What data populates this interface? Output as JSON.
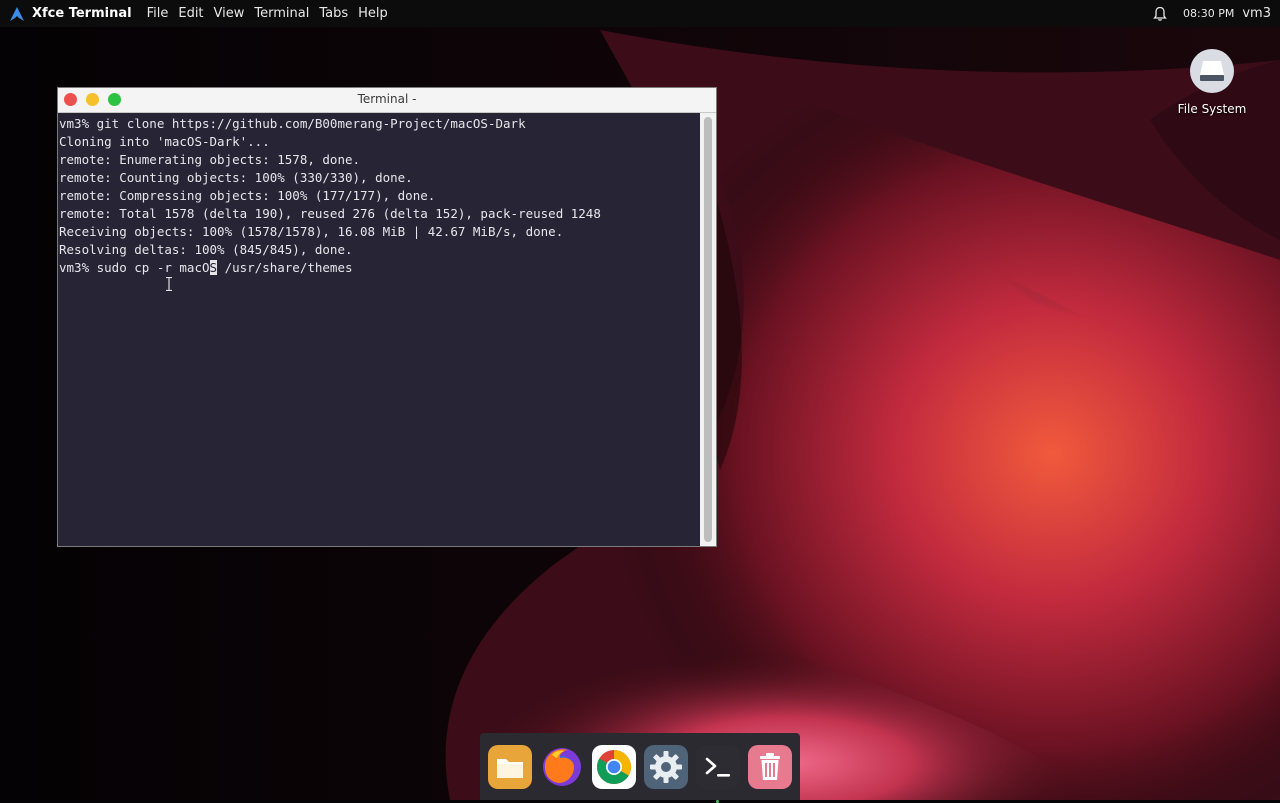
{
  "top_panel": {
    "app_name": "Xfce Terminal",
    "menu": [
      "File",
      "Edit",
      "View",
      "Terminal",
      "Tabs",
      "Help"
    ],
    "clock": "08:30 PM",
    "user": "vm3",
    "icons": {
      "logo": "arch-logo-icon",
      "notifications": "bell-icon"
    }
  },
  "desktop": {
    "icons": [
      {
        "label": "File System",
        "icon": "drive-icon"
      }
    ]
  },
  "terminal": {
    "title": "Terminal -",
    "lines": [
      "vm3% git clone https://github.com/B00merang-Project/macOS-Dark",
      "Cloning into 'macOS-Dark'...",
      "remote: Enumerating objects: 1578, done.",
      "remote: Counting objects: 100% (330/330), done.",
      "remote: Compressing objects: 100% (177/177), done.",
      "remote: Total 1578 (delta 190), reused 276 (delta 152), pack-reused 1248",
      "Receiving objects: 100% (1578/1578), 16.08 MiB | 42.67 MiB/s, done.",
      "Resolving deltas: 100% (845/845), done."
    ],
    "current_line": {
      "before_cursor": "vm3% sudo cp -r macO",
      "cursor_char": "S",
      "after_cursor": " /usr/share/themes"
    }
  },
  "dock": {
    "items": [
      {
        "name": "files",
        "icon": "folder-icon"
      },
      {
        "name": "firefox",
        "icon": "firefox-icon"
      },
      {
        "name": "chrome",
        "icon": "chrome-icon"
      },
      {
        "name": "settings",
        "icon": "settings-gear-icon"
      },
      {
        "name": "terminal",
        "icon": "terminal-icon",
        "running": true
      },
      {
        "name": "trash",
        "icon": "trash-icon"
      }
    ]
  },
  "colors": {
    "terminal_bg": "#272436",
    "terminal_fg": "#e6e6ea",
    "panel_bg": "#0c0c0d",
    "dock_bg": "#2c2a31"
  }
}
